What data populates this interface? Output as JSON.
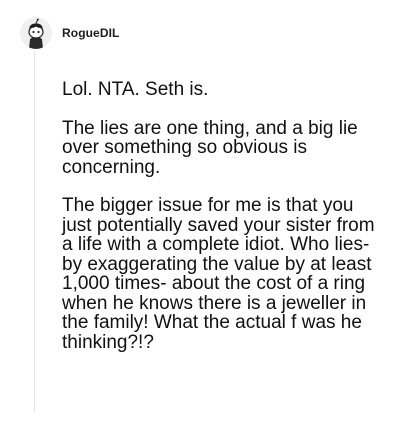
{
  "comment": {
    "username": "RogueDIL",
    "avatar_icon": "snoo-avatar-icon",
    "paragraphs": [
      "Lol. NTA. Seth is.",
      "The lies are one thing, and a big lie over something so obvious is concerning.",
      "The bigger issue for me is that you just potentially saved your sister from a life with a complete idiot. Who lies- by exaggerating the value by at least 1,000 times- about the cost of a ring when he knows there is a jeweller in the family! What the actual f was he thinking?!?"
    ]
  }
}
